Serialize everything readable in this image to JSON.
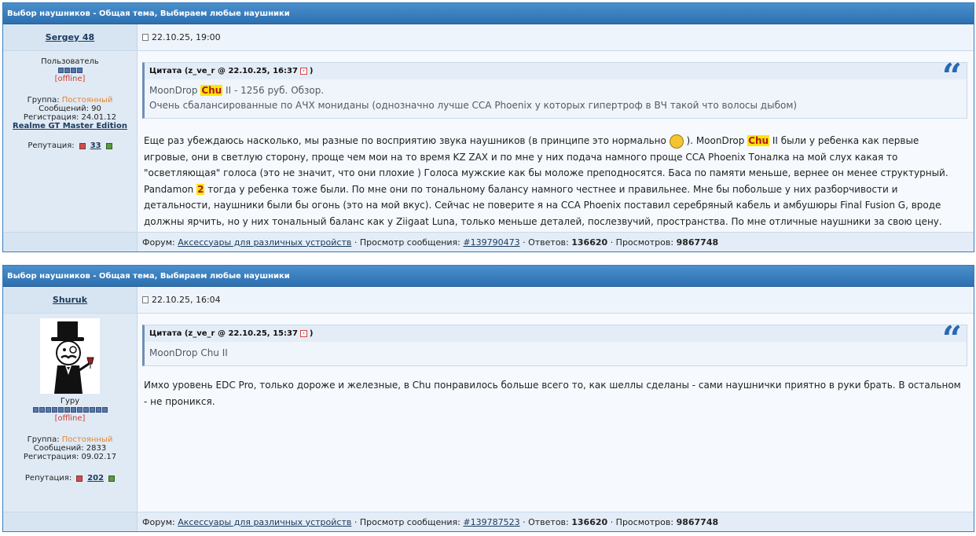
{
  "posts": [
    {
      "header": "Выбор наушников - Общая тема, Выбираем любые наушники",
      "author": "Sergey 48",
      "date": "22.10.25, 19:00",
      "role": "Пользователь",
      "status": "[offline]",
      "group_label": "Группа:",
      "group_value": "Постоянный",
      "messages": "Сообщений: 90",
      "registration": "Регистрация: 24.01.12",
      "device": "Realme GT Master Edition",
      "reputation_label": "Репутация:",
      "reputation_value": "33",
      "quote": {
        "title": "Цитата (z_ve_r @ 22.10.25, 16:37",
        "close": ")",
        "line1_pre": "MoonDrop ",
        "line1_hl": "Chu",
        "line1_post": " II - 1256 руб. Обзор.",
        "line2": "Очень сбалансированные по АЧХ мониданы (однозначно лучше CCA Phoenix у которых гипертроф в ВЧ такой что волосы дыбом)"
      },
      "text": {
        "p1": "Еще раз убеждаюсь насколько, мы разные по восприятию звука наушников (в принципе это нормально ",
        "p2": " ). MoonDrop ",
        "hl1": "Chu",
        "p3": " II были у ребенка как первые игровые, они в светлую сторону, проще чем мои на то время KZ ZAX и по мне у них подача намного проще CCA Phoenix Тоналка на мой слух какая то \"осветляющая\" голоса (это не значит, что они плохие ) Голоса мужские как бы моложе преподносятся. Баса по памяти меньше, вернее он менее структурный. Pandamon ",
        "hl2": "2",
        "p4": " тогда у ребенка тоже были. По мне они по тональному балансу намного честнее и правильнее. Мне бы побольше у них разборчивости и детальности, наушники были бы огонь (это на мой вкус). Сейчас не поверите я на CCA Phoenix поставил серебряный кабель и амбушюры Final Fusion G, вроде должны ярчить, но у них тональный баланс как у Ziigaat Luna, только меньше деталей, послезвучий, пространства. По мне отличные наушники за свою цену."
      },
      "footer": {
        "forum_label": "Форум:",
        "forum_link": "Аксессуары для различных устройств",
        "view_label": "· Просмотр сообщения:",
        "view_link": "#139790473",
        "replies_label": "· Ответов:",
        "replies_value": "136620",
        "views_label": "· Просмотров:",
        "views_value": "9867748"
      }
    },
    {
      "header": "Выбор наушников - Общая тема, Выбираем любые наушники",
      "author": "Shuruk",
      "date": "22.10.25, 16:04",
      "role": "Гуру",
      "status": "[offline]",
      "group_label": "Группа:",
      "group_value": "Постоянный",
      "messages": "Сообщений: 2833",
      "registration": "Регистрация: 09.02.17",
      "reputation_label": "Репутация:",
      "reputation_value": "202",
      "quote": {
        "title": "Цитата (z_ve_r @ 22.10.25, 15:37",
        "close": ")",
        "line1": "MoonDrop Chu II"
      },
      "text": "Имхо уровень EDC Pro, только дороже и железные, в Chu понравилось больше всего то, как шеллы сделаны - сами наушнички приятно в руки брать. В остальном - не проникся.",
      "footer": {
        "forum_label": "Форум:",
        "forum_link": "Аксессуары для различных устройств",
        "view_label": "· Просмотр сообщения:",
        "view_link": "#139787523",
        "replies_label": "· Ответов:",
        "replies_value": "136620",
        "views_label": "· Просмотров:",
        "views_value": "9867748"
      }
    }
  ],
  "icons": {
    "date": "document-icon",
    "quote_back": "back-arrow-icon",
    "quote_mark": "quote-mark-icon",
    "smiley": "smiley-icon",
    "rep_minus": "minus-icon",
    "rep_plus": "plus-icon",
    "rank": "star-icon"
  },
  "colors": {
    "header_bg": "#2d6fb0",
    "highlight": "#ffe600",
    "offline": "#d13b2c",
    "group": "#e8842a",
    "quote_mark": "#2b68b3"
  },
  "quote_glyph": "“"
}
